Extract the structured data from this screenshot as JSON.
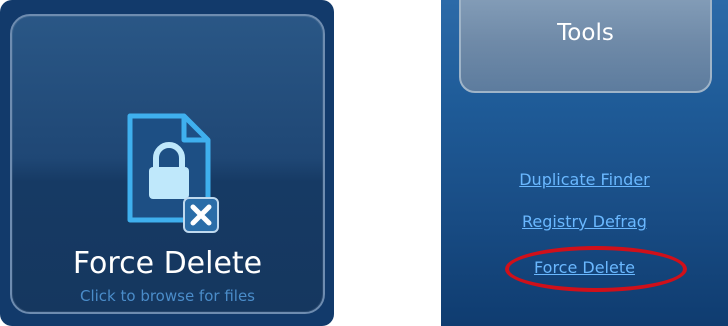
{
  "force_delete_tile": {
    "title": "Force Delete",
    "subtitle": "Click to browse for files",
    "icon": "locked-file-delete-icon"
  },
  "sidebar": {
    "tools_label": "Tools",
    "links": [
      {
        "label": "Duplicate Finder"
      },
      {
        "label": "Registry Defrag"
      },
      {
        "label": "Force Delete",
        "highlighted": true
      }
    ]
  },
  "colors": {
    "panel_background": "#123a6b",
    "link": "#6ab8ff",
    "highlight": "#d0101a"
  }
}
